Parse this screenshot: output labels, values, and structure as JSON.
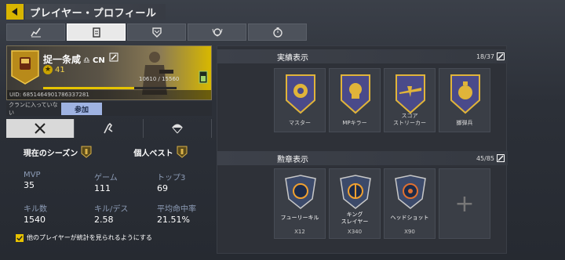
{
  "header": {
    "title": "プレイヤー・プロフィール"
  },
  "tabs": [
    {
      "icon": "stats-chart-icon",
      "active": false
    },
    {
      "icon": "clipboard-icon",
      "active": true
    },
    {
      "icon": "shield-badge-icon",
      "active": false
    },
    {
      "icon": "wreath-icon",
      "active": false
    },
    {
      "icon": "stopwatch-icon",
      "active": false
    }
  ],
  "profile": {
    "name": "捉一条咸",
    "region_prefix": "♎",
    "region": "CN",
    "level": "41",
    "xp": "10610 / 15560",
    "xp_fraction": 0.68,
    "uid": "UID: 6851464901786337281"
  },
  "clan": {
    "status": "クランに入っていない",
    "join_label": "参加"
  },
  "season": {
    "current_label": "現在のシーズン",
    "best_label": "個人ベスト"
  },
  "stats": [
    {
      "label": "MVP",
      "value": "35"
    },
    {
      "label": "ゲーム",
      "value": "111"
    },
    {
      "label": "トップ3",
      "value": "69"
    },
    {
      "label": "キル数",
      "value": "1540"
    },
    {
      "label": "キル/デス",
      "value": "2.58"
    },
    {
      "label": "平均命中率",
      "value": "21.51%"
    }
  ],
  "share": {
    "label": "他のプレイヤーが統計を見られるようにする",
    "checked": true
  },
  "achievements": {
    "title": "実績表示",
    "count": "18/37",
    "items": [
      {
        "label": "マスター"
      },
      {
        "label": "MPキラー"
      },
      {
        "label": "スコア\nストリーカー"
      },
      {
        "label": "擲弾兵"
      }
    ]
  },
  "medals": {
    "title": "勲章表示",
    "count": "45/85",
    "items": [
      {
        "label": "フューリーキル",
        "count": "X12"
      },
      {
        "label": "キング\nスレイヤー",
        "count": "X340"
      },
      {
        "label": "ヘッドショット",
        "count": "X90"
      }
    ]
  },
  "colors": {
    "accent": "#e6c400",
    "join": "#9fb3e2",
    "stat_label": "#8c9bb5"
  }
}
